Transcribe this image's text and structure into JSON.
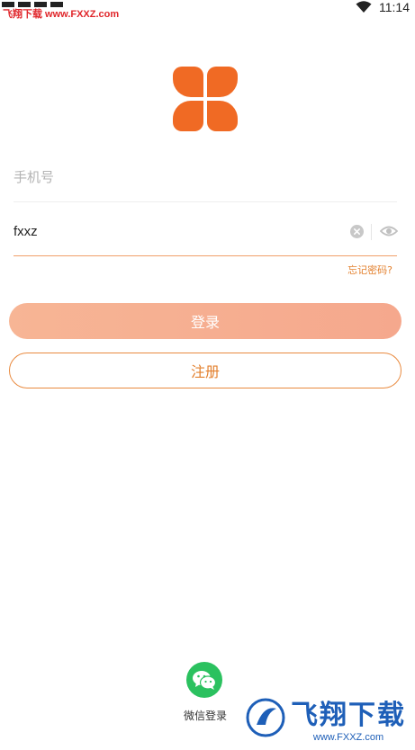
{
  "statusbar": {
    "watermark": "飞翔下载 www.FXXZ.com",
    "time": "11:14",
    "wifi_icon": "wifi-icon"
  },
  "login": {
    "phone_placeholder": "手机号",
    "password_value": "fxxz",
    "forgot_label": "忘记密码?",
    "login_label": "登录",
    "register_label": "注册"
  },
  "social": {
    "wechat_icon": "wechat-icon",
    "wechat_label": "微信登录"
  },
  "watermark_br": {
    "title": "飞翔下载",
    "url": "www.FXXZ.com"
  },
  "colors": {
    "accent": "#e3802e",
    "login_gradient_start": "#f7b595",
    "login_gradient_end": "#f5a88d",
    "logo_orange": "#f06a24",
    "wechat_green": "#2bc15f"
  }
}
